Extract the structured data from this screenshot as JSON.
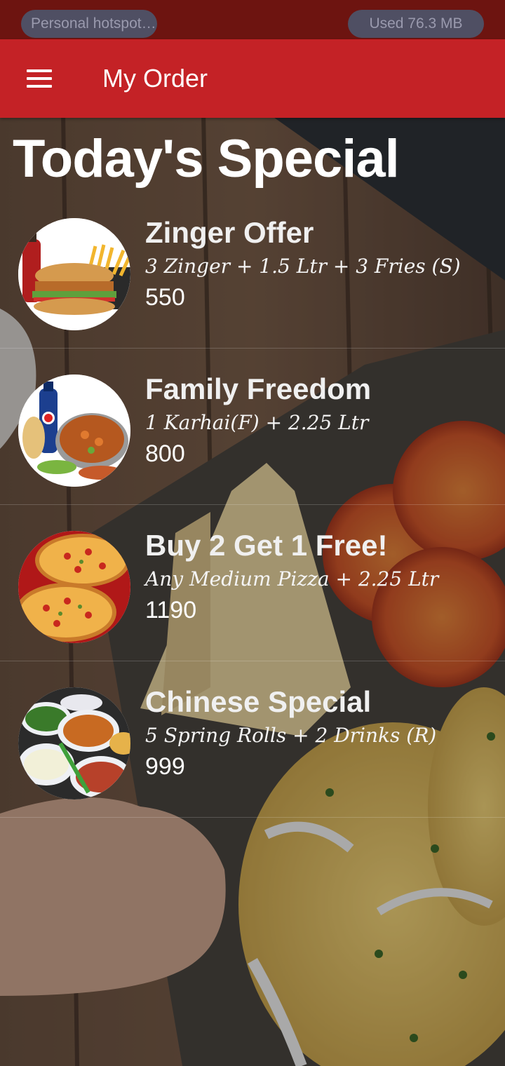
{
  "status_bar": {
    "hotspot_label": "Personal hotspot…",
    "data_usage": "Used  76.3 MB"
  },
  "app_bar": {
    "menu_icon": "hamburger-menu-icon",
    "title": "My Order"
  },
  "section_title": "Today's Special",
  "specials": [
    {
      "name": "Zinger Offer",
      "description": "3 Zinger + 1.5 Ltr + 3 Fries (S)",
      "price": "550",
      "image": "burger-combo-image"
    },
    {
      "name": "Family Freedom",
      "description": "1 Karhai(F) + 2.25 Ltr",
      "price": "800",
      "image": "karhai-meal-image"
    },
    {
      "name": "Buy 2 Get 1 Free!",
      "description": "Any Medium Pizza + 2.25 Ltr",
      "price": "1190",
      "image": "pizza-image"
    },
    {
      "name": "Chinese Special",
      "description": "5 Spring Rolls + 2 Drinks (R)",
      "price": "999",
      "image": "chinese-platter-image"
    }
  ],
  "colors": {
    "status_bar": "#6d1410",
    "app_bar": "#c42226",
    "text": "#ffffff"
  }
}
